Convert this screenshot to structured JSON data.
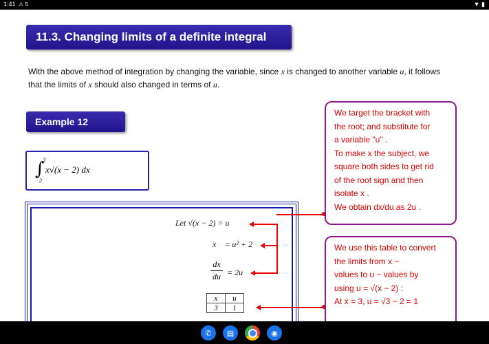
{
  "status": {
    "time": "1:41",
    "icons": "⚠ 5"
  },
  "section_title": "11.3. Changing limits of a definite integral",
  "intro": {
    "p1": "With the above method of integration by changing the variable, since",
    "x1": "x",
    "p2": "is changed to another variable",
    "u1": "u",
    "p3": ", it follows",
    "p4": "that the limits of",
    "x2": "x",
    "p5": "should also changed in terms of",
    "u2": "u",
    "p6": "."
  },
  "example_title": "Example 12",
  "integral": {
    "upper": "3",
    "lower": "2",
    "body": "x√(x − 2) dx"
  },
  "solution": {
    "let_line": "Let √(x − 2) = u",
    "x_line": "x    = u² + 2",
    "deriv_num": "dx",
    "deriv_den": "du",
    "deriv_rhs": "= 2u",
    "table_headers": [
      "x",
      "u"
    ],
    "table_rows": [
      [
        "3",
        "1"
      ]
    ]
  },
  "note1": {
    "lines": [
      "We target the bracket with",
      "the root; and substitute for",
      "a variable \"u\" .",
      "To make x the subject, we",
      "square both sides to get rid",
      "of the root sign and then",
      "isolate x .",
      "We obtain  dx/du  as  2u ."
    ]
  },
  "note2": {
    "lines": [
      "We use this table to convert",
      "the limits from x −",
      "values  to u − values  by",
      "using  u = √(x − 2) :",
      "At x = 3,  u = √3 − 2 = 1"
    ]
  },
  "dock_apps": [
    "phone",
    "messages",
    "chrome",
    "camera"
  ],
  "colors": {
    "header_blue": "#2a1aa0",
    "note_border": "#8a1a8a",
    "note_text": "#dd0000"
  }
}
